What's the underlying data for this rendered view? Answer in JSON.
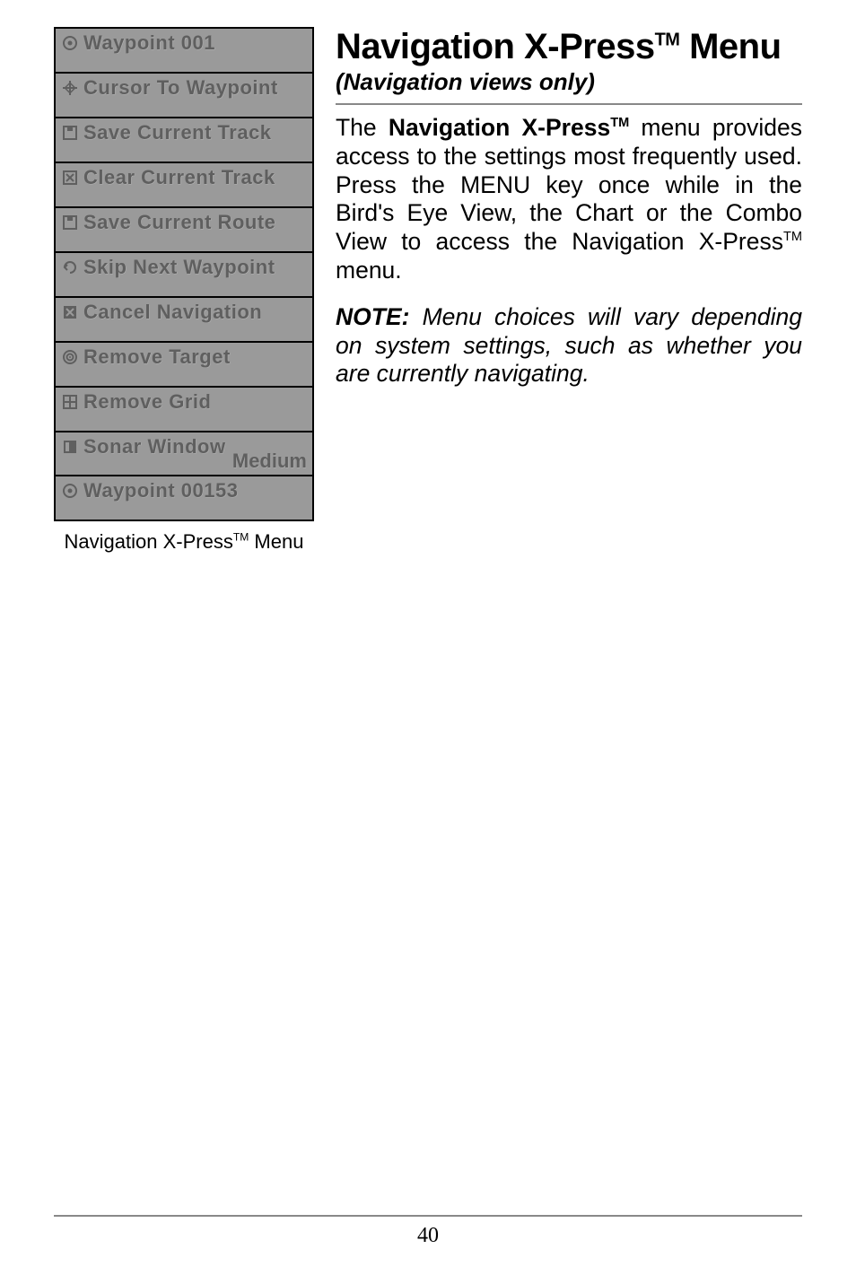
{
  "menu": {
    "caption_prefix": "Navigation X-Press",
    "caption_tm": "TM",
    "caption_suffix": " Menu",
    "items": [
      {
        "icon": "waypoint-icon",
        "label": "Waypoint 001"
      },
      {
        "icon": "cursor-icon",
        "label": "Cursor To Waypoint"
      },
      {
        "icon": "save-track-icon",
        "label": "Save Current Track"
      },
      {
        "icon": "clear-track-icon",
        "label": "Clear Current Track"
      },
      {
        "icon": "save-route-icon",
        "label": "Save Current Route"
      },
      {
        "icon": "skip-icon",
        "label": "Skip Next Waypoint"
      },
      {
        "icon": "cancel-nav-icon",
        "label": "Cancel Navigation"
      },
      {
        "icon": "remove-target-icon",
        "label": "Remove Target"
      },
      {
        "icon": "remove-grid-icon",
        "label": "Remove Grid"
      },
      {
        "icon": "sonar-window-icon",
        "label": "Sonar Window",
        "sub": "Medium"
      },
      {
        "icon": "waypoint-icon",
        "label": "Waypoint 00153"
      }
    ]
  },
  "heading": {
    "prefix": "Navigation X-Press",
    "tm": "TM",
    "suffix": " Menu"
  },
  "sub_heading": "(Navigation views only)",
  "paragraph": {
    "pre_bold": "The ",
    "bold_prefix": "Navigation X-Press",
    "bold_tm": "TM",
    "post_bold_pre_tm": " menu provides access to the settings most frequently used.  Press the MENU key once while in the Bird's Eye View, the Chart or the Combo View to access the Navigation X-Press",
    "tm2": "TM",
    "tail": " menu."
  },
  "note": {
    "label": "NOTE:",
    "text": "  Menu choices will vary depending on system settings, such as whether you are currently navigating."
  },
  "page_number": "40"
}
